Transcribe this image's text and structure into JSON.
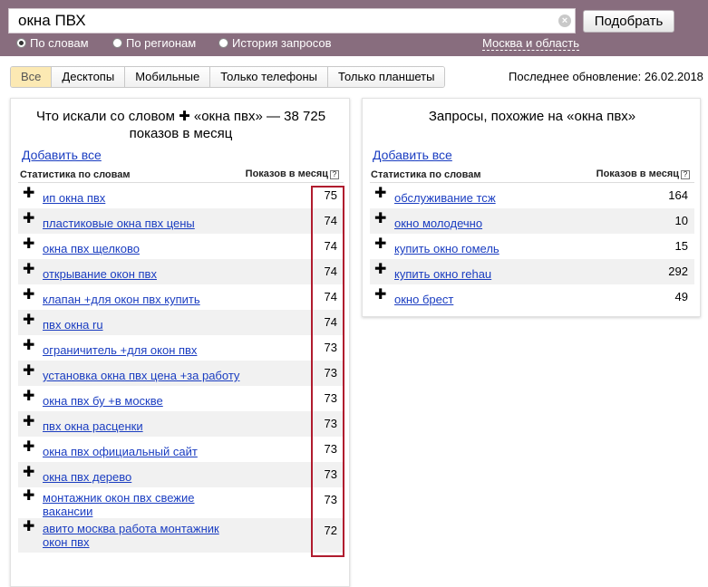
{
  "search": {
    "value": "окна ПВХ",
    "clear_symbol": "×"
  },
  "submit_label": "Подобрать",
  "modes": [
    {
      "label": "По словам",
      "selected": true
    },
    {
      "label": "По регионам",
      "selected": false
    },
    {
      "label": "История запросов",
      "selected": false
    }
  ],
  "region": "Москва и область",
  "tabs": [
    {
      "label": "Все",
      "active": true
    },
    {
      "label": "Десктопы",
      "active": false
    },
    {
      "label": "Мобильные",
      "active": false
    },
    {
      "label": "Только телефоны",
      "active": false
    },
    {
      "label": "Только планшеты",
      "active": false
    }
  ],
  "last_update": "Последнее обновление: 26.02.2018",
  "left_panel": {
    "title": "Что искали со словом ✚ «окна пвх» — 38 725 показов в месяц",
    "add_all": "Добавить все",
    "col_words": "Статистика по словам",
    "col_shows": "Показов в месяц",
    "help": "?",
    "rows": [
      {
        "phrase": "ип окна пвх",
        "count": "75"
      },
      {
        "phrase": "пластиковые окна пвх цены",
        "count": "74"
      },
      {
        "phrase": "окна пвх щелково",
        "count": "74"
      },
      {
        "phrase": "открывание окон пвх",
        "count": "74"
      },
      {
        "phrase": "клапан +для окон пвх купить",
        "count": "74"
      },
      {
        "phrase": "пвх окна ru",
        "count": "74"
      },
      {
        "phrase": "ограничитель +для окон пвх",
        "count": "73"
      },
      {
        "phrase": "установка окна пвх цена +за работу",
        "count": "73"
      },
      {
        "phrase": "окна пвх бу +в москве",
        "count": "73"
      },
      {
        "phrase": "пвх окна расценки",
        "count": "73"
      },
      {
        "phrase": "окна пвх официальный сайт",
        "count": "73"
      },
      {
        "phrase": "окна пвх дерево",
        "count": "73"
      },
      {
        "phrase": "монтажник окон пвх свежие вакансии",
        "count": "73"
      },
      {
        "phrase": "авито москва работа монтажник окон пвх",
        "count": "72"
      }
    ]
  },
  "right_panel": {
    "title": "Запросы, похожие на «окна пвх»",
    "add_all": "Добавить все",
    "col_words": "Статистика по словам",
    "col_shows": "Показов в месяц",
    "help": "?",
    "rows": [
      {
        "phrase": "обслуживание тсж",
        "count": "164"
      },
      {
        "phrase": "окно молодечно",
        "count": "10"
      },
      {
        "phrase": "купить окно гомель",
        "count": "15"
      },
      {
        "phrase": "купить окно rehau",
        "count": "292"
      },
      {
        "phrase": "окно брест",
        "count": "49"
      }
    ]
  },
  "plus_symbol": "✚",
  "colors": {
    "header_bg": "#886d7e",
    "link": "#1a3dc1",
    "highlight": "#b01b2e",
    "active_tab": "#fce9b3"
  }
}
